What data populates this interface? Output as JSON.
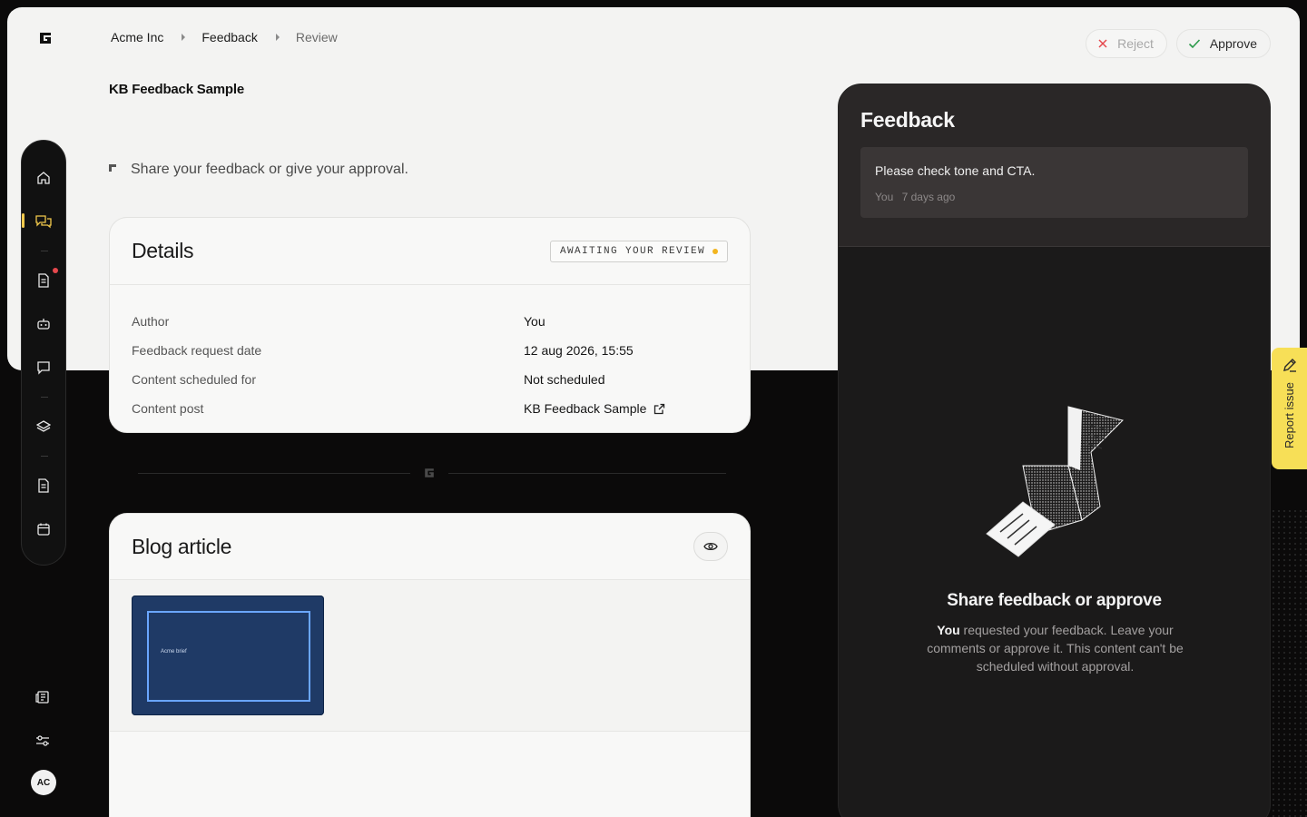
{
  "breadcrumb": {
    "items": [
      "Acme Inc",
      "Feedback",
      "Review"
    ]
  },
  "page": {
    "title": "KB Feedback Sample",
    "hint": "Share your feedback or give your approval."
  },
  "actions": {
    "reject_label": "Reject",
    "approve_label": "Approve"
  },
  "details": {
    "title": "Details",
    "status": "AWAITING YOUR REVIEW",
    "status_color": "#f2b51f",
    "rows": [
      {
        "label": "Author",
        "value": "You"
      },
      {
        "label": "Feedback request date",
        "value": "12 aug 2026, 15:55"
      },
      {
        "label": "Content scheduled for",
        "value": "Not scheduled"
      },
      {
        "label": "Content post",
        "value": "KB Feedback Sample"
      }
    ]
  },
  "blog": {
    "title": "Blog article",
    "thumb_text": "Acme brief"
  },
  "feedback": {
    "title": "Feedback",
    "comment": {
      "text": "Please check tone and CTA.",
      "author": "You",
      "time": "7 days ago"
    },
    "empty_title": "Share feedback or approve",
    "empty_desc_bold": "You",
    "empty_desc": " requested your feedback. Leave your comments or approve it. This content can't be scheduled without approval."
  },
  "sidebar": {
    "user_initials": "AC",
    "icons": [
      "home-icon",
      "feedback-icon",
      "document-icon",
      "robot-icon",
      "chat-icon",
      "layers-icon",
      "page-icon",
      "calendar-icon"
    ],
    "bottom_icons": [
      "news-icon",
      "settings-sliders-icon"
    ]
  },
  "report": {
    "label": "Report issue"
  },
  "colors": {
    "accent": "#f2c94c",
    "report_bg": "#f7df57",
    "thumb_bg": "#1f3a66"
  }
}
